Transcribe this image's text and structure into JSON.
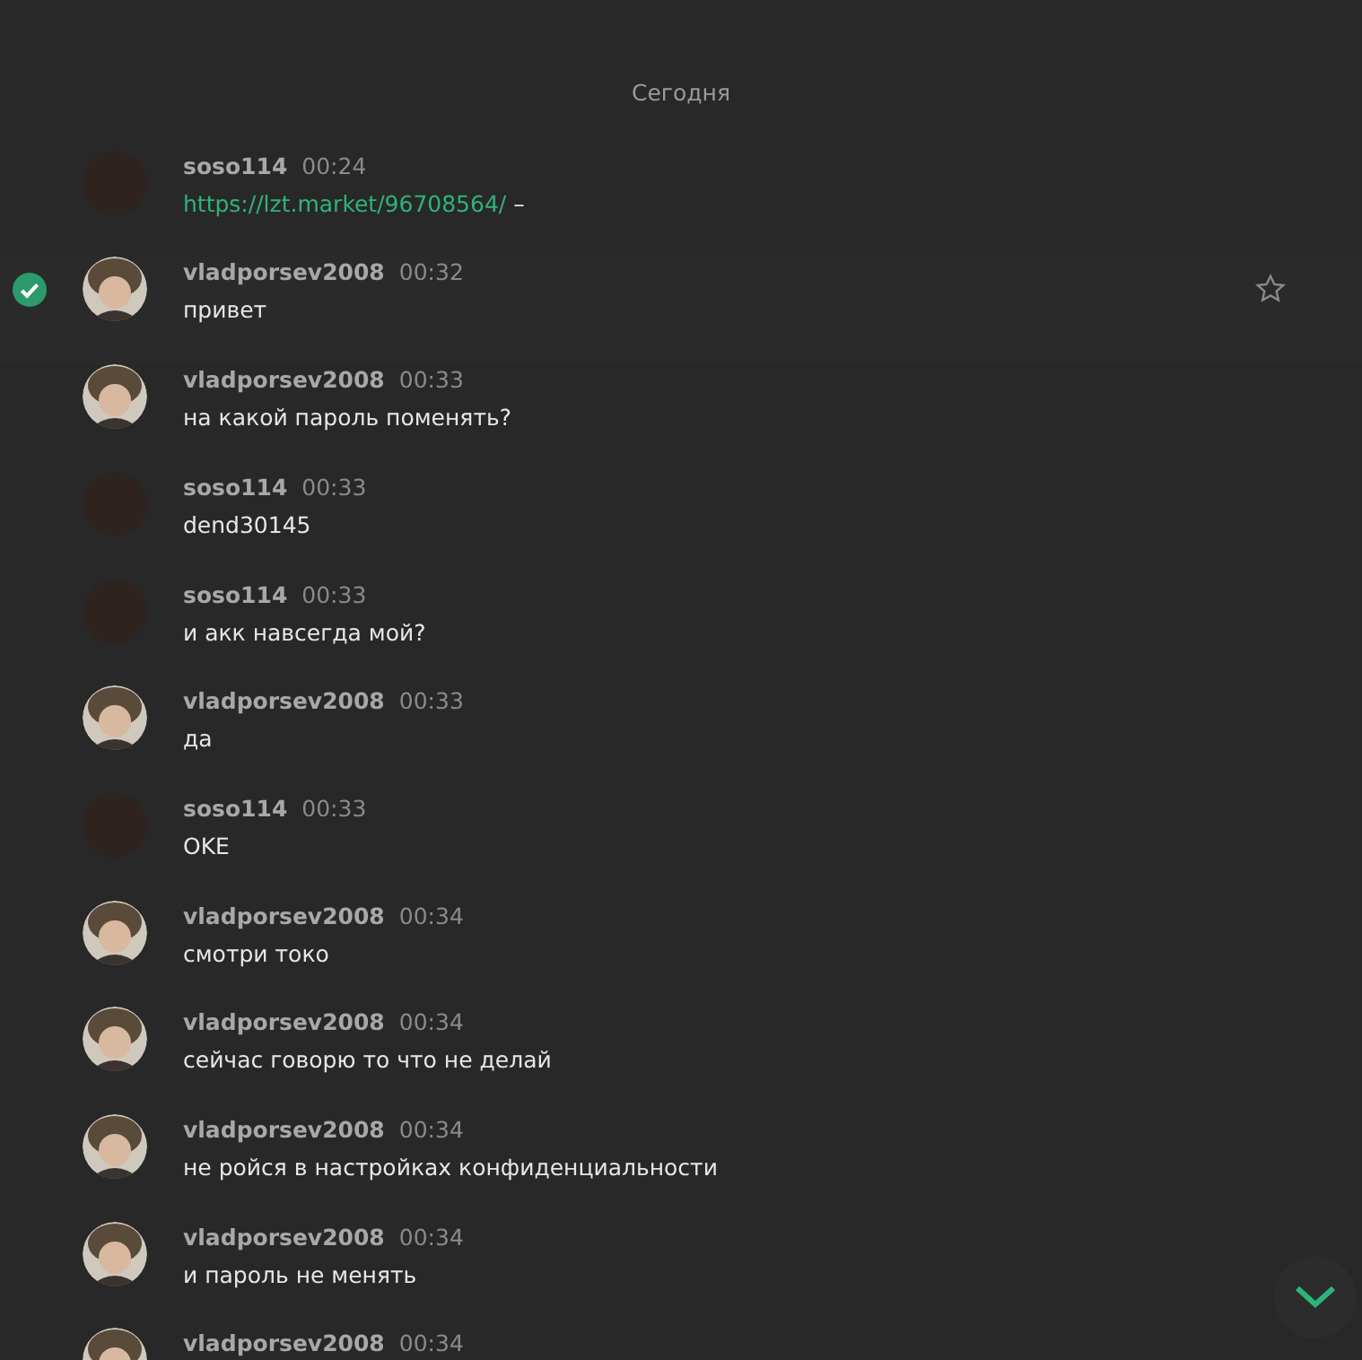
{
  "date_separator": "Сегодня",
  "messages": [
    {
      "author": "soso114",
      "time": "00:24",
      "kind": "blank",
      "link": "https://lzt.market/96708564/",
      "text": " –",
      "selected": false
    },
    {
      "author": "vladporsev2008",
      "time": "00:32",
      "kind": "photo",
      "text": "привет",
      "selected": true
    },
    {
      "author": "vladporsev2008",
      "time": "00:33",
      "kind": "photo",
      "text": "на какой пароль поменять?",
      "selected": false
    },
    {
      "author": "soso114",
      "time": "00:33",
      "kind": "blank",
      "text": "dend30145",
      "selected": false
    },
    {
      "author": "soso114",
      "time": "00:33",
      "kind": "blank",
      "text": "и акк навсегда мой?",
      "selected": false
    },
    {
      "author": "vladporsev2008",
      "time": "00:33",
      "kind": "photo",
      "text": "да",
      "selected": false
    },
    {
      "author": "soso114",
      "time": "00:33",
      "kind": "blank",
      "text": "OKE",
      "selected": false
    },
    {
      "author": "vladporsev2008",
      "time": "00:34",
      "kind": "photo",
      "text": "смотри токо",
      "selected": false
    },
    {
      "author": "vladporsev2008",
      "time": "00:34",
      "kind": "photo",
      "text": "сейчас говорю то что не делай",
      "selected": false
    },
    {
      "author": "vladporsev2008",
      "time": "00:34",
      "kind": "photo",
      "text": "не ройся в настройках конфиденциальности",
      "selected": false
    },
    {
      "author": "vladporsev2008",
      "time": "00:34",
      "kind": "photo",
      "text": "и пароль не менять",
      "selected": false
    },
    {
      "author": "vladporsev2008",
      "time": "00:34",
      "kind": "photo",
      "selected": false
    }
  ]
}
